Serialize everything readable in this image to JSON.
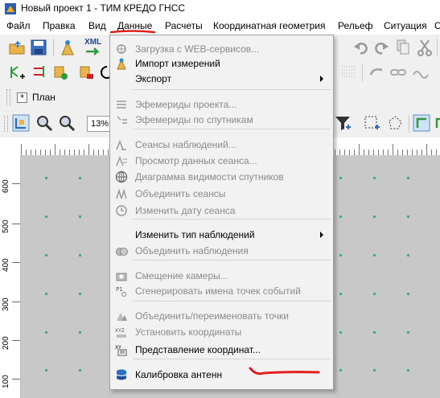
{
  "window": {
    "title": "Новый проект 1 - ТИМ КРЕДО ГНСС"
  },
  "menubar": {
    "items": [
      {
        "label": "Файл"
      },
      {
        "label": "Правка"
      },
      {
        "label": "Вид"
      },
      {
        "label": "Данные"
      },
      {
        "label": "Расчеты"
      },
      {
        "label": "Координатная геометрия"
      },
      {
        "label": "Рельеф"
      },
      {
        "label": "Ситуация"
      },
      {
        "label": "С"
      }
    ]
  },
  "plan_panel": {
    "label": "План",
    "expand_symbol": "+"
  },
  "zoom": {
    "value": "13%"
  },
  "ruler": {
    "left_labels": [
      "600",
      "500",
      "400",
      "300",
      "200",
      "100"
    ]
  },
  "toolbar": {
    "xml_label": "XML"
  },
  "data_menu": {
    "items": [
      {
        "label": "Загрузка с WEB-сервисов...",
        "enabled": false,
        "icon": "web-services-icon"
      },
      {
        "label": "Импорт измерений",
        "enabled": true,
        "icon": "import-icon"
      },
      {
        "label": "Экспорт",
        "enabled": true,
        "submenu": true,
        "icon": ""
      },
      {
        "label": "Эфемериды проекта...",
        "enabled": false,
        "icon": "ephemeris-icon"
      },
      {
        "label": "Эфемериды по спутникам",
        "enabled": false,
        "icon": "satellite-ephemeris-icon"
      },
      {
        "label": "Сеансы наблюдений...",
        "enabled": false,
        "icon": "sessions-icon"
      },
      {
        "label": "Просмотр данных сеанса...",
        "enabled": false,
        "icon": "session-data-icon"
      },
      {
        "label": "Диаграмма видимости спутников",
        "enabled": false,
        "icon": "visibility-diagram-icon"
      },
      {
        "label": "Объединить сеансы",
        "enabled": false,
        "icon": "merge-sessions-icon"
      },
      {
        "label": "Изменить дату сеанса",
        "enabled": false,
        "icon": "session-date-icon"
      },
      {
        "label": "Изменить тип наблюдений",
        "enabled": true,
        "submenu": true,
        "icon": ""
      },
      {
        "label": "Объединить наблюдения",
        "enabled": false,
        "icon": "merge-observations-icon"
      },
      {
        "label": "Смещение камеры...",
        "enabled": false,
        "icon": "camera-offset-icon"
      },
      {
        "label": "Сгенерировать имена точек событий",
        "enabled": false,
        "icon": "event-points-icon",
        "icon_text": "P1"
      },
      {
        "label": "Объединить/переименовать точки",
        "enabled": false,
        "icon": "rename-points-icon"
      },
      {
        "label": "Установить координаты",
        "enabled": false,
        "icon": "set-coordinates-icon",
        "icon_text": "XYZ"
      },
      {
        "label": "Представление координат...",
        "enabled": true,
        "icon": "coordinates-view-icon",
        "icon_text": "XY"
      },
      {
        "label": "Калибровка антенн",
        "enabled": true,
        "icon": "antenna-calibration-icon"
      }
    ]
  },
  "colors": {
    "accent_red": "#e0201e",
    "grid_point": "#4aa58e",
    "canvas": "#c8c8c8",
    "menu_bg": "#f2f2f2"
  }
}
